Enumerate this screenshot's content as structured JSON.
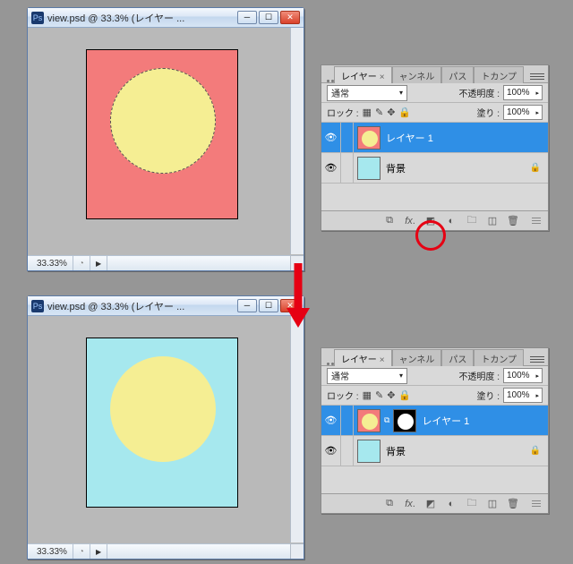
{
  "doc_top": {
    "title": "view.psd @ 33.3% (レイヤー ...",
    "zoom": "33.33%",
    "artboard_color": "#f37b7b",
    "circle_color": "#f5ee93",
    "has_selection": true
  },
  "doc_bottom": {
    "title": "view.psd @ 33.3% (レイヤー ...",
    "zoom": "33.33%",
    "artboard_color": "#a6e8ee",
    "circle_color": "#f5ee93",
    "has_selection": false
  },
  "panel_top": {
    "tabs": {
      "layers": "レイヤー",
      "channels": "ャンネル",
      "paths": "パス",
      "comps": "トカンプ"
    },
    "blend_mode": "通常",
    "opacity_label": "不透明度 :",
    "opacity_value": "100%",
    "lock_label": "ロック :",
    "fill_label": "塗り :",
    "fill_value": "100%",
    "layers": [
      {
        "name": "レイヤー 1",
        "selected": true,
        "has_mask": false,
        "locked": false,
        "thumb_bg": "#f37b7b",
        "thumb_fg": "#f5ee93"
      },
      {
        "name": "背景",
        "selected": false,
        "has_mask": false,
        "locked": true,
        "thumb_bg": "#a6e8ee",
        "thumb_fg": ""
      }
    ]
  },
  "panel_bottom": {
    "tabs": {
      "layers": "レイヤー",
      "channels": "ャンネル",
      "paths": "パス",
      "comps": "トカンプ"
    },
    "blend_mode": "通常",
    "opacity_label": "不透明度 :",
    "opacity_value": "100%",
    "lock_label": "ロック :",
    "fill_label": "塗り :",
    "fill_value": "100%",
    "layers": [
      {
        "name": "レイヤー 1",
        "selected": true,
        "has_mask": true,
        "locked": false,
        "thumb_bg": "#f37b7b",
        "thumb_fg": "#f5ee93"
      },
      {
        "name": "背景",
        "selected": false,
        "has_mask": false,
        "locked": true,
        "thumb_bg": "#a6e8ee",
        "thumb_fg": ""
      }
    ]
  },
  "icons": {
    "ps": "Ps"
  }
}
